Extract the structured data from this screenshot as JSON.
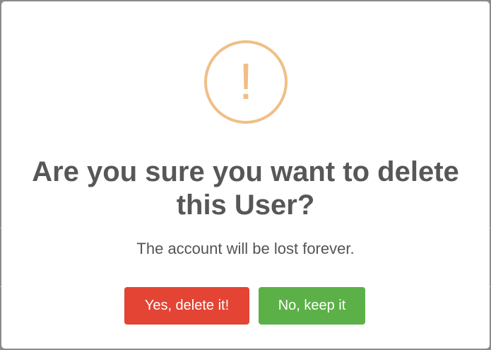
{
  "dialog": {
    "icon": "warning-exclamation-icon",
    "icon_glyph": "!",
    "title": "Are you sure you want to delete this User?",
    "message": "The account will be lost forever.",
    "confirm_label": "Yes, delete it!",
    "cancel_label": "No, keep it"
  },
  "colors": {
    "warning": "#f0bf86",
    "confirm": "#e34434",
    "cancel": "#5bb147",
    "title_text": "#575757",
    "message_text": "#545454"
  }
}
